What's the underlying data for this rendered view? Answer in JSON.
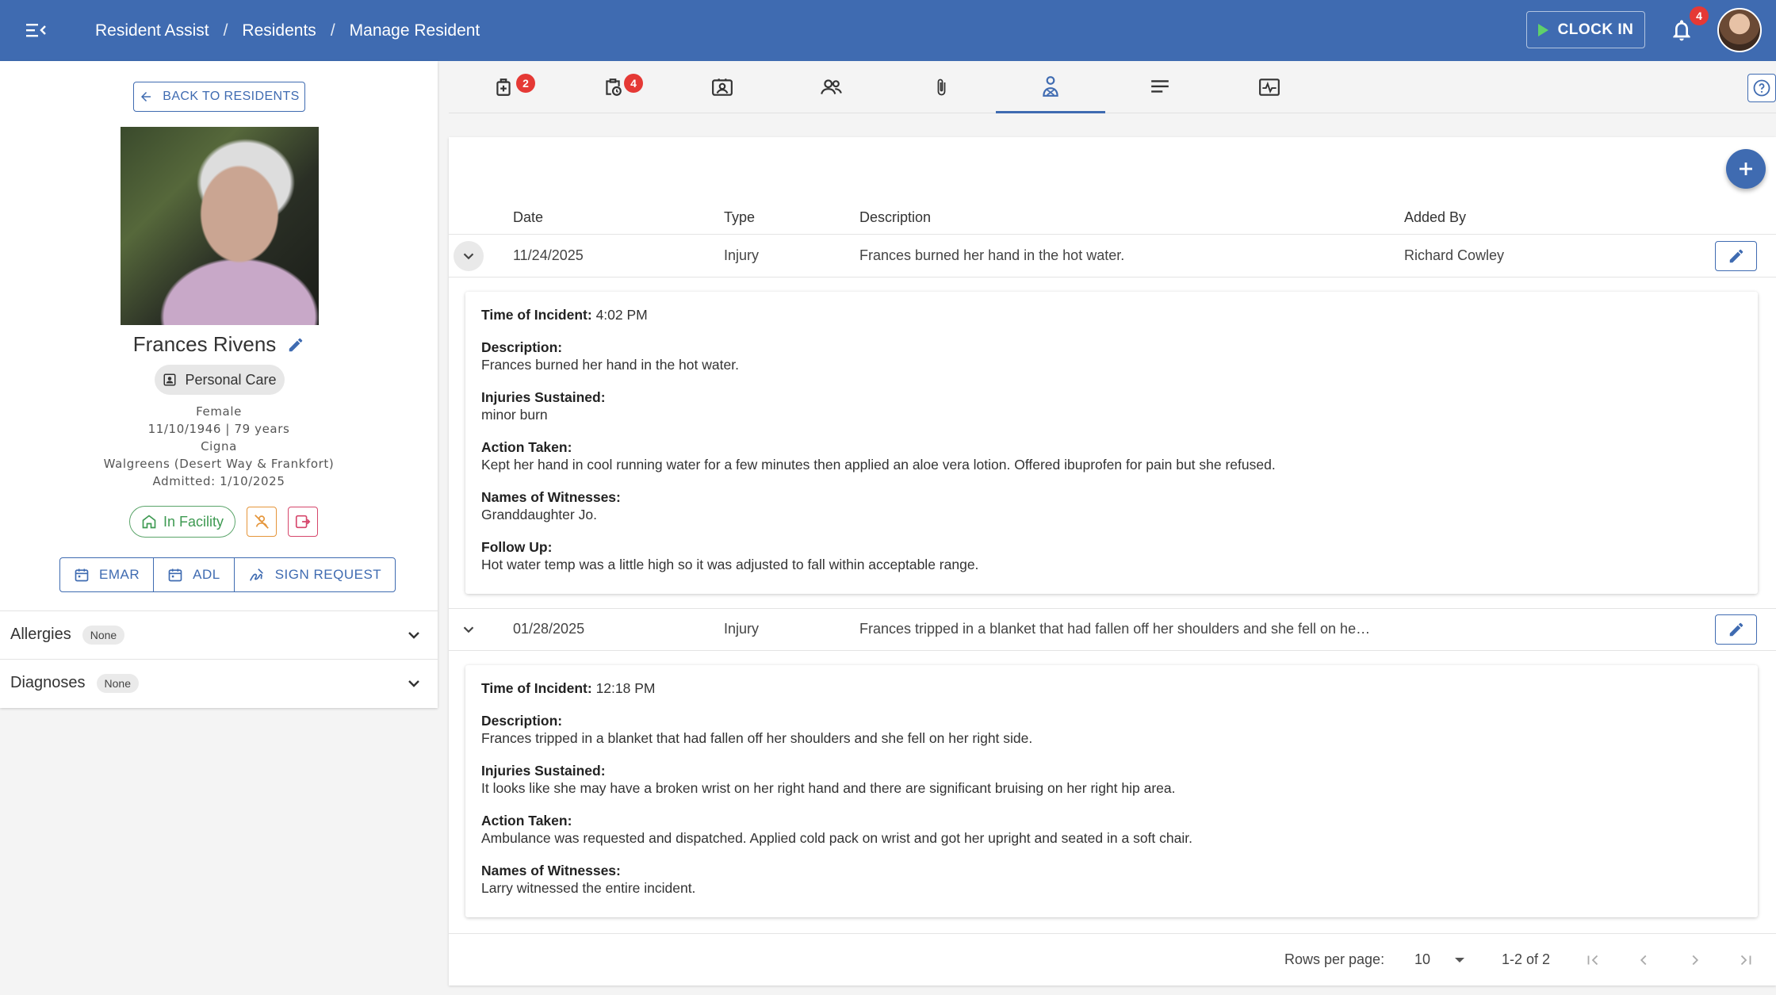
{
  "header": {
    "breadcrumbs": [
      "Resident Assist",
      "Residents",
      "Manage Resident"
    ],
    "separator": "/",
    "clock_in_label": "CLOCK IN",
    "notification_count": "4",
    "colors": {
      "bar": "#3f6bb1",
      "play": "#5fd06a",
      "badge": "#e53935"
    }
  },
  "resident": {
    "back_label": "BACK TO RESIDENTS",
    "name": "Frances Rivens",
    "care_level": "Personal Care",
    "gender": "Female",
    "dob_age": "11/10/1946 | 79 years",
    "insurance": "Cigna",
    "pharmacy": "Walgreens (Desert Way & Frankfort)",
    "admitted": "Admitted: 1/10/2025",
    "status": "In Facility",
    "buttons": {
      "emar": "EMAR",
      "adl": "ADL",
      "sign_request": "SIGN REQUEST"
    },
    "allergies": {
      "label": "Allergies",
      "value": "None"
    },
    "diagnoses": {
      "label": "Diagnoses",
      "value": "None"
    }
  },
  "tabs": [
    {
      "icon": "medical-bag-icon",
      "badge": "2"
    },
    {
      "icon": "clipboard-clock-icon",
      "badge": "4"
    },
    {
      "icon": "contact-card-icon",
      "badge": ""
    },
    {
      "icon": "people-icon",
      "badge": ""
    },
    {
      "icon": "paperclip-icon",
      "badge": ""
    },
    {
      "icon": "person-injury-icon",
      "badge": "",
      "active": true
    },
    {
      "icon": "notes-lines-icon",
      "badge": ""
    },
    {
      "icon": "vitals-chart-icon",
      "badge": ""
    }
  ],
  "table": {
    "headers": {
      "date": "Date",
      "type": "Type",
      "description": "Description",
      "added_by": "Added By"
    },
    "rows": [
      {
        "date": "11/24/2025",
        "type": "Injury",
        "description": "Frances burned her hand in the hot water.",
        "added_by": "Richard Cowley",
        "details": {
          "time_label": "Time of Incident:",
          "time": "4:02 PM",
          "description_label": "Description:",
          "description": "Frances burned her hand in the hot water.",
          "injuries_label": "Injuries Sustained:",
          "injuries": "minor burn",
          "action_label": "Action Taken:",
          "action": "Kept her hand in cool running water for a few minutes then applied an aloe vera lotion. Offered ibuprofen for pain but she refused.",
          "witnesses_label": "Names of Witnesses:",
          "witnesses": "Granddaughter Jo.",
          "followup_label": "Follow Up:",
          "followup": "Hot water temp was a little high so it was adjusted to fall within acceptable range."
        }
      },
      {
        "date": "01/28/2025",
        "type": "Injury",
        "description": "Frances tripped in a blanket that had fallen off her shoulders and she fell on he…",
        "added_by": "",
        "details": {
          "time_label": "Time of Incident:",
          "time": "12:18 PM",
          "description_label": "Description:",
          "description": "Frances tripped in a blanket that had fallen off her shoulders and she fell on her right side.",
          "injuries_label": "Injuries Sustained:",
          "injuries": "It looks like she may have a broken wrist on her right hand and there are significant bruising on her right hip area.",
          "action_label": "Action Taken:",
          "action": "Ambulance was requested and dispatched.  Applied cold pack on wrist and got her upright and seated in a soft chair.",
          "witnesses_label": "Names of Witnesses:",
          "witnesses": "Larry witnessed the entire incident."
        }
      }
    ]
  },
  "pagination": {
    "rows_per_page_label": "Rows per page:",
    "rows_per_page": "10",
    "range": "1-2 of 2"
  }
}
